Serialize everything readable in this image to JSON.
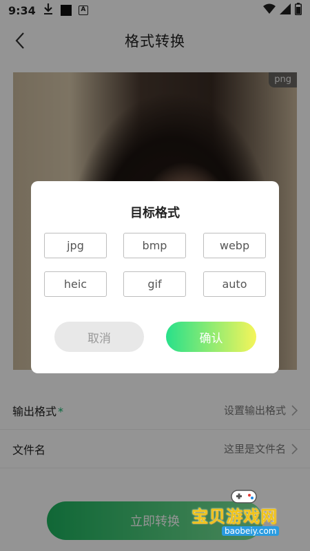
{
  "status_bar": {
    "time": "9:34",
    "icons": [
      "download-icon",
      "black-square-icon",
      "a-badge-icon",
      "wifi-icon",
      "signal-icon",
      "battery-icon"
    ],
    "badge_text": "A"
  },
  "header": {
    "title": "格式转换",
    "back_icon": "chevron-left-icon"
  },
  "preview": {
    "format_tag": "png"
  },
  "form": {
    "output_format": {
      "label": "输出格式",
      "required_mark": "*",
      "value": "设置输出格式"
    },
    "file_name": {
      "label": "文件名",
      "value": "这里是文件名"
    }
  },
  "convert_button": {
    "label": "立即转换"
  },
  "watermark": {
    "text": "宝贝游戏网",
    "url": "baobeiy.com"
  },
  "dialog": {
    "title": "目标格式",
    "options": [
      "jpg",
      "bmp",
      "webp",
      "heic",
      "gif",
      "auto"
    ],
    "cancel_label": "取消",
    "confirm_label": "确认"
  },
  "colors": {
    "accent_green": "#1db35f",
    "confirm_gradient_start": "#28e08a",
    "confirm_gradient_end": "#f5f55a",
    "watermark_gold": "#f0c419"
  }
}
